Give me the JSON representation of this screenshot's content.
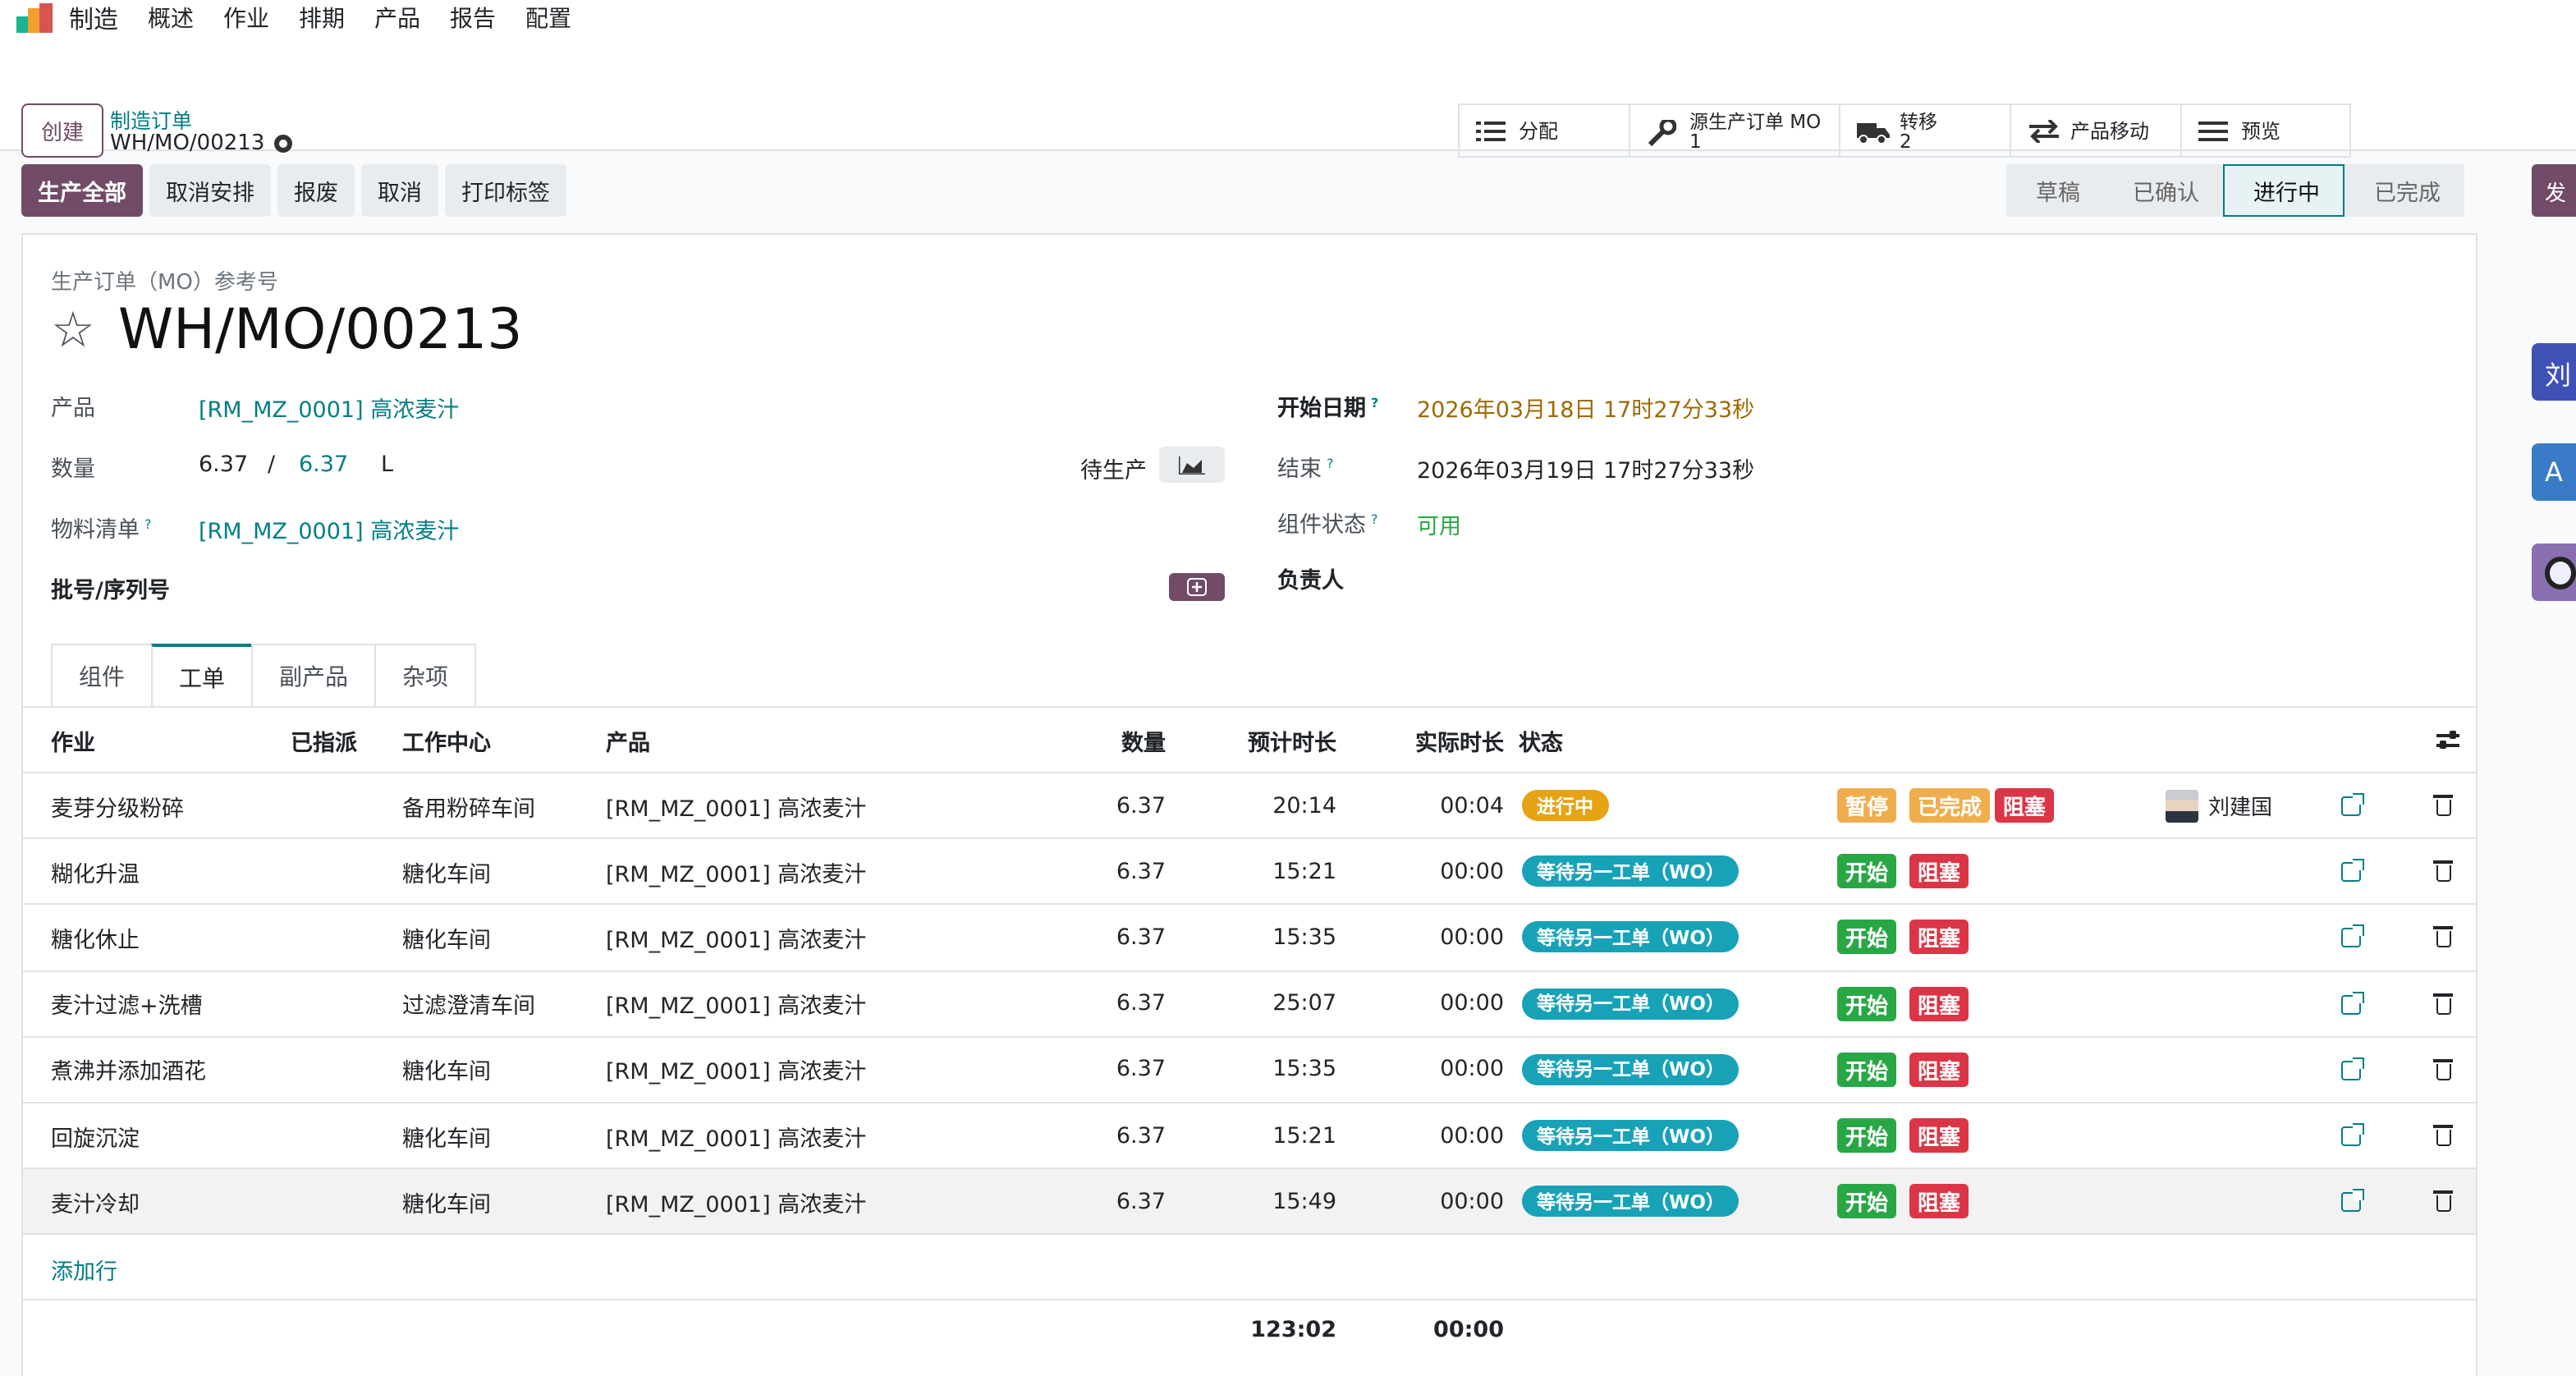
{
  "nav": {
    "app_title": "制造",
    "items": [
      "概述",
      "作业",
      "排期",
      "产品",
      "报告",
      "配置"
    ]
  },
  "control": {
    "create_label": "创建",
    "breadcrumb": "制造订单",
    "record_name": "WH/MO/00213",
    "smart_buttons": [
      {
        "icon": "list-icon",
        "label": "分配",
        "sub": ""
      },
      {
        "icon": "wrench-icon",
        "label": "源生产订单 MO",
        "sub": "1"
      },
      {
        "icon": "truck-icon",
        "label": "转移",
        "sub": "2"
      },
      {
        "icon": "exchange-icon",
        "label": "产品移动",
        "sub": ""
      },
      {
        "icon": "menu-icon",
        "label": "预览",
        "sub": ""
      }
    ]
  },
  "actions": {
    "produce_all": "生产全部",
    "unplan": "取消安排",
    "scrap": "报废",
    "cancel": "取消",
    "print_labels": "打印标签"
  },
  "status": {
    "stages": [
      "草稿",
      "已确认",
      "进行中",
      "已完成"
    ],
    "active": "进行中"
  },
  "side": {
    "send": "发",
    "avatar1": "刘",
    "avatar2": "A"
  },
  "form": {
    "ref_label": "生产订单（MO）参考号",
    "name": "WH/MO/00213",
    "product_label": "产品",
    "product_value": "[RM_MZ_0001] 高浓麦汁",
    "qty_label": "数量",
    "qty_produced": "6.37",
    "qty_sep": "/",
    "qty_total": "6.37",
    "qty_uom": "L",
    "to_produce_label": "待生产",
    "bom_label": "物料清单",
    "bom_value": "[RM_MZ_0001] 高浓麦汁",
    "lot_label": "批号/序列号",
    "start_label": "开始日期",
    "start_value": "2026年03月18日 17时27分33秒",
    "end_label": "结束",
    "end_value": "2026年03月19日 17时27分33秒",
    "component_status_label": "组件状态",
    "component_status_value": "可用",
    "responsible_label": "负责人",
    "help_mark": "?"
  },
  "tabs": [
    "组件",
    "工单",
    "副产品",
    "杂项"
  ],
  "active_tab": "工单",
  "table": {
    "headers": {
      "operation": "作业",
      "assigned": "已指派",
      "workcenter": "工作中心",
      "product": "产品",
      "qty": "数量",
      "expected": "预计时长",
      "real": "实际时长",
      "status": "状态"
    },
    "rows": [
      {
        "operation": "麦芽分级粉碎",
        "workcenter": "备用粉碎车间",
        "product": "[RM_MZ_0001] 高浓麦汁",
        "qty": "6.37",
        "expected": "20:14",
        "real": "00:04",
        "status": "进行中",
        "status_color": "#e6a313",
        "buttons": [
          "暂停",
          "已完成",
          "阻塞"
        ],
        "user": "刘建国"
      },
      {
        "operation": "糊化升温",
        "workcenter": "糖化车间",
        "product": "[RM_MZ_0001] 高浓麦汁",
        "qty": "6.37",
        "expected": "15:21",
        "real": "00:00",
        "status": "等待另一工单（WO）",
        "status_color": "#17a2b8",
        "buttons": [
          "开始",
          "阻塞"
        ],
        "user": ""
      },
      {
        "operation": "糖化休止",
        "workcenter": "糖化车间",
        "product": "[RM_MZ_0001] 高浓麦汁",
        "qty": "6.37",
        "expected": "15:35",
        "real": "00:00",
        "status": "等待另一工单（WO）",
        "status_color": "#17a2b8",
        "buttons": [
          "开始",
          "阻塞"
        ],
        "user": ""
      },
      {
        "operation": "麦汁过滤+洗槽",
        "workcenter": "过滤澄清车间",
        "product": "[RM_MZ_0001] 高浓麦汁",
        "qty": "6.37",
        "expected": "25:07",
        "real": "00:00",
        "status": "等待另一工单（WO）",
        "status_color": "#17a2b8",
        "buttons": [
          "开始",
          "阻塞"
        ],
        "user": ""
      },
      {
        "operation": "煮沸并添加酒花",
        "workcenter": "糖化车间",
        "product": "[RM_MZ_0001] 高浓麦汁",
        "qty": "6.37",
        "expected": "15:35",
        "real": "00:00",
        "status": "等待另一工单（WO）",
        "status_color": "#17a2b8",
        "buttons": [
          "开始",
          "阻塞"
        ],
        "user": ""
      },
      {
        "operation": "回旋沉淀",
        "workcenter": "糖化车间",
        "product": "[RM_MZ_0001] 高浓麦汁",
        "qty": "6.37",
        "expected": "15:21",
        "real": "00:00",
        "status": "等待另一工单（WO）",
        "status_color": "#17a2b8",
        "buttons": [
          "开始",
          "阻塞"
        ],
        "user": ""
      },
      {
        "operation": "麦汁冷却",
        "workcenter": "糖化车间",
        "product": "[RM_MZ_0001] 高浓麦汁",
        "qty": "6.37",
        "expected": "15:49",
        "real": "00:00",
        "status": "等待另一工单（WO）",
        "status_color": "#17a2b8",
        "buttons": [
          "开始",
          "阻塞"
        ],
        "user": ""
      }
    ],
    "add_line": "添加行",
    "total_expected": "123:02",
    "total_real": "00:00"
  },
  "colors": {
    "brand": "#714b67",
    "link": "#017e84",
    "pause": "#f0ad4e",
    "done": "#f0ad4e",
    "block": "#dc3545",
    "start": "#28a745"
  }
}
